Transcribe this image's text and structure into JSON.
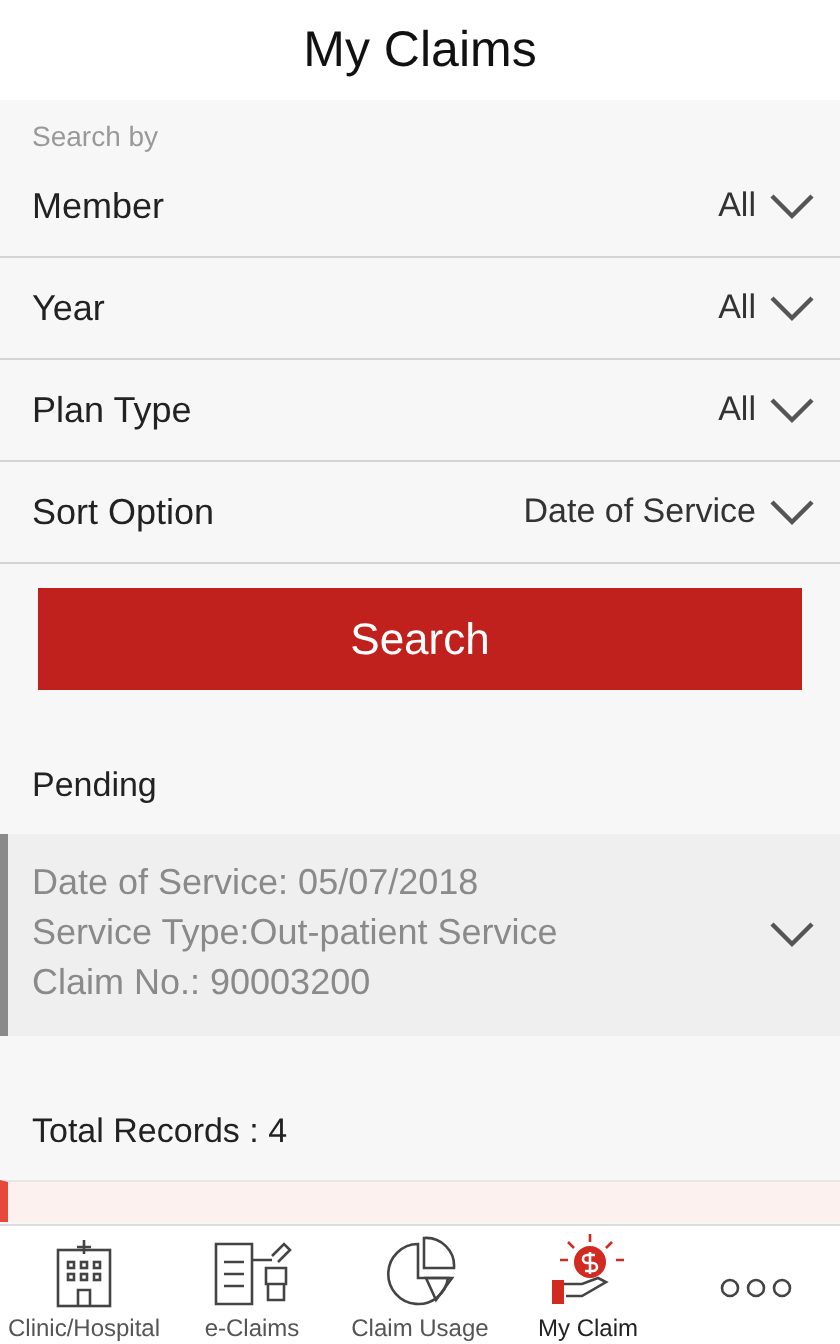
{
  "header": {
    "title": "My Claims"
  },
  "search_by": {
    "label": "Search by",
    "filters": [
      {
        "label": "Member",
        "value": "All"
      },
      {
        "label": "Year",
        "value": "All"
      },
      {
        "label": "Plan Type",
        "value": "All"
      },
      {
        "label": "Sort Option",
        "value": "Date of Service"
      }
    ],
    "button": "Search"
  },
  "pending": {
    "label": "Pending",
    "claims": [
      {
        "lines": [
          "Date of Service: 05/07/2018",
          "Service Type:Out-patient Service",
          "Claim No.: 90003200"
        ],
        "expanded": false
      }
    ]
  },
  "total_records": "Total Records : 4",
  "records": [
    {
      "kind": "partial"
    }
  ],
  "tab_bar": [
    {
      "kind": "hospital",
      "label": "Clinic/Hospital",
      "selected": false
    },
    {
      "kind": "eclaims",
      "label": "e-Claims",
      "selected": false
    },
    {
      "kind": "usage",
      "label": "Claim Usage",
      "selected": false
    },
    {
      "kind": "myclaims",
      "label": "My Claim",
      "selected": true
    },
    {
      "kind": "more",
      "selected": false
    }
  ]
}
